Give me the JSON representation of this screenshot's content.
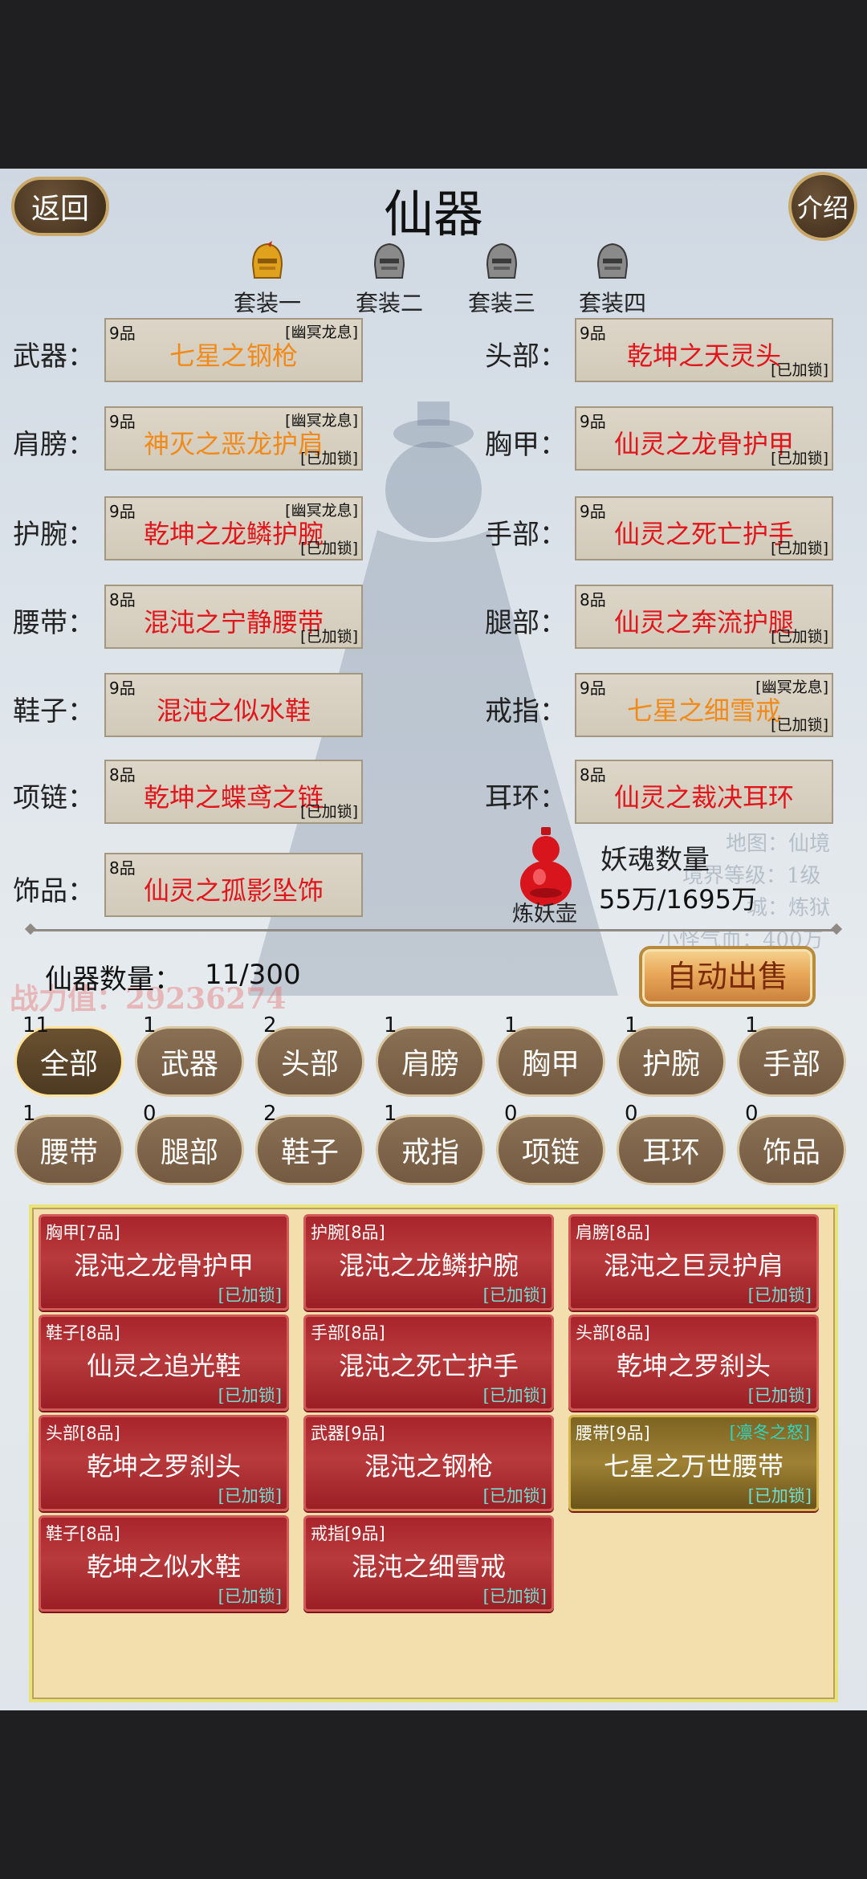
{
  "header": {
    "back_label": "返回",
    "title": "仙器",
    "intro_label": "介绍"
  },
  "set_tabs": [
    {
      "label": "套装一",
      "active": true
    },
    {
      "label": "套装二",
      "active": false
    },
    {
      "label": "套装三",
      "active": false
    },
    {
      "label": "套装四",
      "active": false
    }
  ],
  "slots": {
    "weapon": {
      "label": "武器：",
      "grade": "9品",
      "tag": "[幽冥龙息]",
      "name": "七星之钢枪",
      "lock": "",
      "color": "#f08a1a"
    },
    "head": {
      "label": "头部：",
      "grade": "9品",
      "tag": "",
      "name": "乾坤之天灵头",
      "lock": "[已加锁]",
      "color": "#e0161c"
    },
    "shoulder": {
      "label": "肩膀：",
      "grade": "9品",
      "tag": "[幽冥龙息]",
      "name": "神灭之恶龙护肩",
      "lock": "[已加锁]",
      "color": "#f08a1a"
    },
    "chest": {
      "label": "胸甲：",
      "grade": "9品",
      "tag": "",
      "name": "仙灵之龙骨护甲",
      "lock": "[已加锁]",
      "color": "#e0161c"
    },
    "wrist": {
      "label": "护腕：",
      "grade": "9品",
      "tag": "[幽冥龙息]",
      "name": "乾坤之龙鳞护腕",
      "lock": "[已加锁]",
      "color": "#e0161c"
    },
    "hand": {
      "label": "手部：",
      "grade": "9品",
      "tag": "",
      "name": "仙灵之死亡护手",
      "lock": "[已加锁]",
      "color": "#e0161c"
    },
    "belt": {
      "label": "腰带：",
      "grade": "8品",
      "tag": "",
      "name": "混沌之宁静腰带",
      "lock": "[已加锁]",
      "color": "#e0161c"
    },
    "leg": {
      "label": "腿部：",
      "grade": "8品",
      "tag": "",
      "name": "仙灵之奔流护腿",
      "lock": "[已加锁]",
      "color": "#e0161c"
    },
    "shoes": {
      "label": "鞋子：",
      "grade": "9品",
      "tag": "",
      "name": "混沌之似水鞋",
      "lock": "",
      "color": "#e0161c"
    },
    "ring": {
      "label": "戒指：",
      "grade": "9品",
      "tag": "[幽冥龙息]",
      "name": "七星之细雪戒",
      "lock": "[已加锁]",
      "color": "#f08a1a"
    },
    "necklace": {
      "label": "项链：",
      "grade": "8品",
      "tag": "",
      "name": "乾坤之蝶鸢之链",
      "lock": "[已加锁]",
      "color": "#e0161c"
    },
    "earring": {
      "label": "耳环：",
      "grade": "8品",
      "tag": "",
      "name": "仙灵之裁决耳环",
      "lock": "",
      "color": "#e0161c"
    },
    "ornament": {
      "label": "饰品：",
      "grade": "8品",
      "tag": "",
      "name": "仙灵之孤影坠饰",
      "lock": "",
      "color": "#e0161c"
    }
  },
  "soul": {
    "pot_label": "炼妖壶",
    "title": "妖魂数量",
    "value": "55万/1695万"
  },
  "inventory": {
    "count_label": "仙器数量：",
    "count_value": "11/300",
    "auto_sell_label": "自动出售"
  },
  "background": {
    "power_label": "战力值：29236274",
    "info_lines": [
      "地图：仙境",
      "境界等级：1级",
      "城：炼狱",
      "小怪气血：400万"
    ]
  },
  "filters": [
    {
      "label": "全部",
      "count": "11",
      "active": true
    },
    {
      "label": "武器",
      "count": "1"
    },
    {
      "label": "头部",
      "count": "2"
    },
    {
      "label": "肩膀",
      "count": "1"
    },
    {
      "label": "胸甲",
      "count": "1"
    },
    {
      "label": "护腕",
      "count": "1"
    },
    {
      "label": "手部",
      "count": "1"
    },
    {
      "label": "腰带",
      "count": "1"
    },
    {
      "label": "腿部",
      "count": "0"
    },
    {
      "label": "鞋子",
      "count": "2"
    },
    {
      "label": "戒指",
      "count": "1"
    },
    {
      "label": "项链",
      "count": "0"
    },
    {
      "label": "耳环",
      "count": "0"
    },
    {
      "label": "饰品",
      "count": "0"
    }
  ],
  "items": [
    {
      "head": "胸甲[7品]",
      "name": "混沌之龙骨护甲",
      "lock": "[已加锁]",
      "tag": "",
      "style": "red"
    },
    {
      "head": "护腕[8品]",
      "name": "混沌之龙鳞护腕",
      "lock": "[已加锁]",
      "tag": "",
      "style": "red"
    },
    {
      "head": "肩膀[8品]",
      "name": "混沌之巨灵护肩",
      "lock": "[已加锁]",
      "tag": "",
      "style": "red"
    },
    {
      "head": "鞋子[8品]",
      "name": "仙灵之追光鞋",
      "lock": "[已加锁]",
      "tag": "",
      "style": "red"
    },
    {
      "head": "手部[8品]",
      "name": "混沌之死亡护手",
      "lock": "[已加锁]",
      "tag": "",
      "style": "red"
    },
    {
      "head": "头部[8品]",
      "name": "乾坤之罗刹头",
      "lock": "[已加锁]",
      "tag": "",
      "style": "red"
    },
    {
      "head": "头部[8品]",
      "name": "乾坤之罗刹头",
      "lock": "[已加锁]",
      "tag": "",
      "style": "red"
    },
    {
      "head": "武器[9品]",
      "name": "混沌之钢枪",
      "lock": "[已加锁]",
      "tag": "",
      "style": "red"
    },
    {
      "head": "腰带[9品]",
      "name": "七星之万世腰带",
      "lock": "[已加锁]",
      "tag": "[凛冬之怒]",
      "style": "gold"
    },
    {
      "head": "鞋子[8品]",
      "name": "乾坤之似水鞋",
      "lock": "[已加锁]",
      "tag": "",
      "style": "red"
    },
    {
      "head": "戒指[9品]",
      "name": "混沌之细雪戒",
      "lock": "[已加锁]",
      "tag": "",
      "style": "red"
    }
  ]
}
